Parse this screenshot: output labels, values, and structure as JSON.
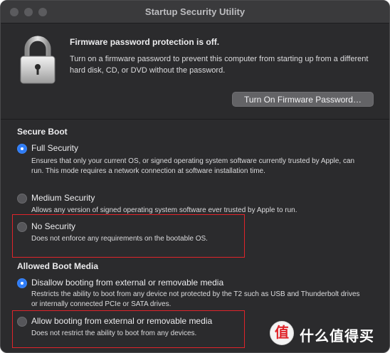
{
  "window": {
    "title": "Startup Security Utility"
  },
  "firmware": {
    "title": "Firmware password protection is off.",
    "description": "Turn on a firmware password to prevent this computer from starting up from a different hard disk, CD, or DVD without the password.",
    "button_label": "Turn On Firmware Password…"
  },
  "secure_boot": {
    "title": "Secure Boot",
    "options": [
      {
        "label": "Full Security",
        "selected": true,
        "description": "Ensures that only your current OS, or signed operating system software currently trusted by Apple, can run. This mode requires a network connection at software installation time."
      },
      {
        "label": "Medium Security",
        "selected": false,
        "description": "Allows any version of signed operating system software ever trusted by Apple to run."
      },
      {
        "label": "No Security",
        "selected": false,
        "description": "Does not enforce any requirements on the bootable OS."
      }
    ]
  },
  "boot_media": {
    "title": "Allowed Boot Media",
    "options": [
      {
        "label": "Disallow booting from external or removable media",
        "selected": true,
        "description": "Restricts the ability to boot from any device not protected by the T2 such as USB and Thunderbolt drives or internally connected PCIe or SATA drives."
      },
      {
        "label": "Allow booting from external or removable media",
        "selected": false,
        "description": "Does not restrict the ability to boot from any devices."
      }
    ]
  },
  "watermark": {
    "badge": "值",
    "text": "什么值得买"
  },
  "colors": {
    "accent": "#2f7cf6",
    "highlight": "#e0242a",
    "background": "#2b2b2d"
  },
  "icons": {
    "lock": "padlock-icon"
  }
}
